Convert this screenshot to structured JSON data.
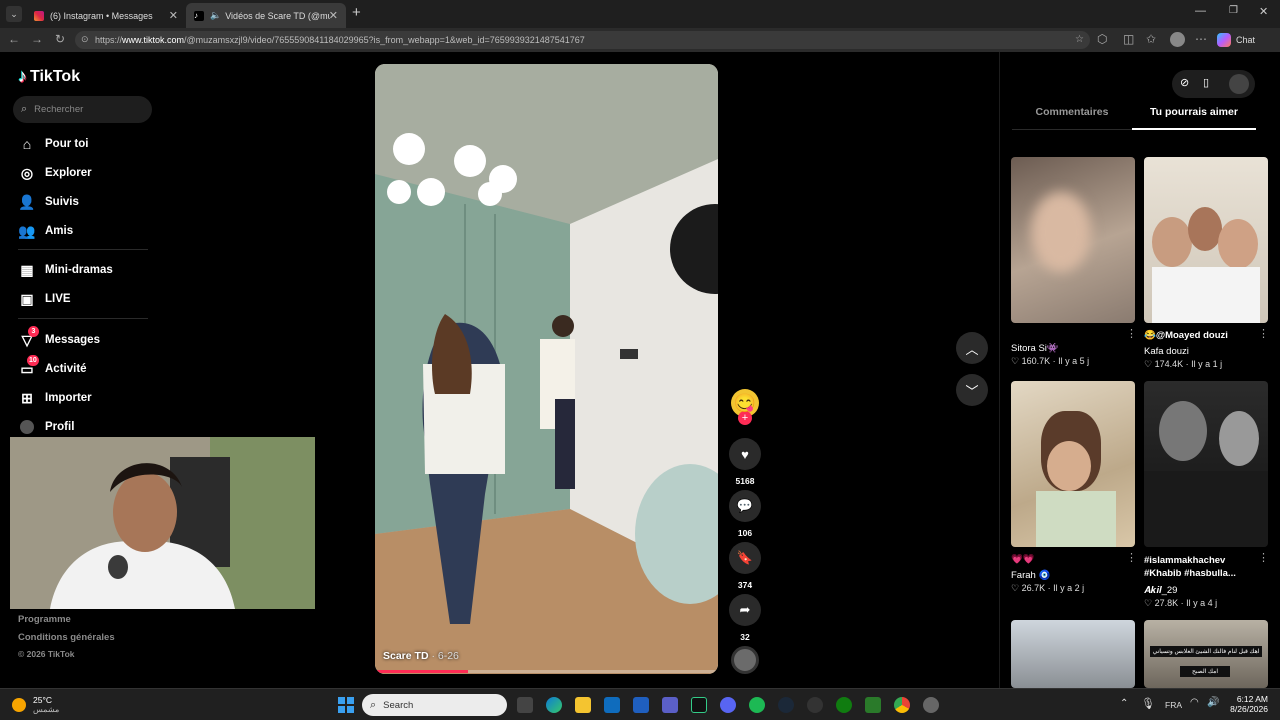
{
  "browser": {
    "tabs": [
      {
        "title": "(6) Instagram • Messages"
      },
      {
        "title": "Vidéos de Scare TD (@muzam"
      }
    ],
    "url_prefix": "https://",
    "url_host": "www.tiktok.com",
    "url_path": "/@muzamsxzjl9/video/7655590841184029965?is_from_webapp=1&web_id=7659939321487541767",
    "chat_label": "Chat"
  },
  "sidebar": {
    "logo": "TikTok",
    "search_placeholder": "Rechercher",
    "items": [
      {
        "label": "Pour toi"
      },
      {
        "label": "Explorer"
      },
      {
        "label": "Suivis"
      },
      {
        "label": "Amis"
      },
      {
        "label": "Mini-dramas"
      },
      {
        "label": "LIVE"
      },
      {
        "label": "Messages",
        "badge": "3"
      },
      {
        "label": "Activité",
        "badge": "10"
      },
      {
        "label": "Importer"
      },
      {
        "label": "Profil"
      }
    ],
    "footer": {
      "program": "Programme",
      "terms": "Conditions générales",
      "copyright": "© 2026 TikTok"
    }
  },
  "video": {
    "author": "Scare TD",
    "date": "· 6-26",
    "progress": 0.27,
    "actions": {
      "likes": "5168",
      "comments": "106",
      "saves": "374",
      "shares": "32"
    }
  },
  "right_panel": {
    "tabs": [
      {
        "label": "Commentaires"
      },
      {
        "label": "Tu pourrais aimer"
      }
    ],
    "active_tab": 1,
    "cards": [
      {
        "caption": "",
        "author": "Sitora Si👾",
        "likes": "160.7K",
        "age": "Il y a 5 j"
      },
      {
        "caption": "😂@Moayed douzi",
        "author": "Kafa douzi",
        "likes": "174.4K",
        "age": "Il y a 1 j"
      },
      {
        "caption": "💗💗",
        "author": "Farah 🧿",
        "likes": "26.7K",
        "age": "Il y a 2 j"
      },
      {
        "caption": "#islammakhachev #Khabib #hasbulla...",
        "author": "𝑨𝒌𝒊𝒍_29",
        "likes": "27.8K",
        "age": "Il y a 4 j"
      }
    ],
    "bottom_thumb_text": [
      "اهك قبل لنام فالنك الشيئ العلابس وتسياني",
      "امك الصبح"
    ]
  },
  "taskbar": {
    "weather_temp": "25°C",
    "weather_desc": "مشمس",
    "search_placeholder": "Search",
    "lang": "FRA",
    "time": "6:12 AM",
    "date": "8/26/2026"
  },
  "colors": {
    "accent": "#fe2c55",
    "tab_active": "#3a3a3a",
    "progress": "#fe2c55"
  }
}
